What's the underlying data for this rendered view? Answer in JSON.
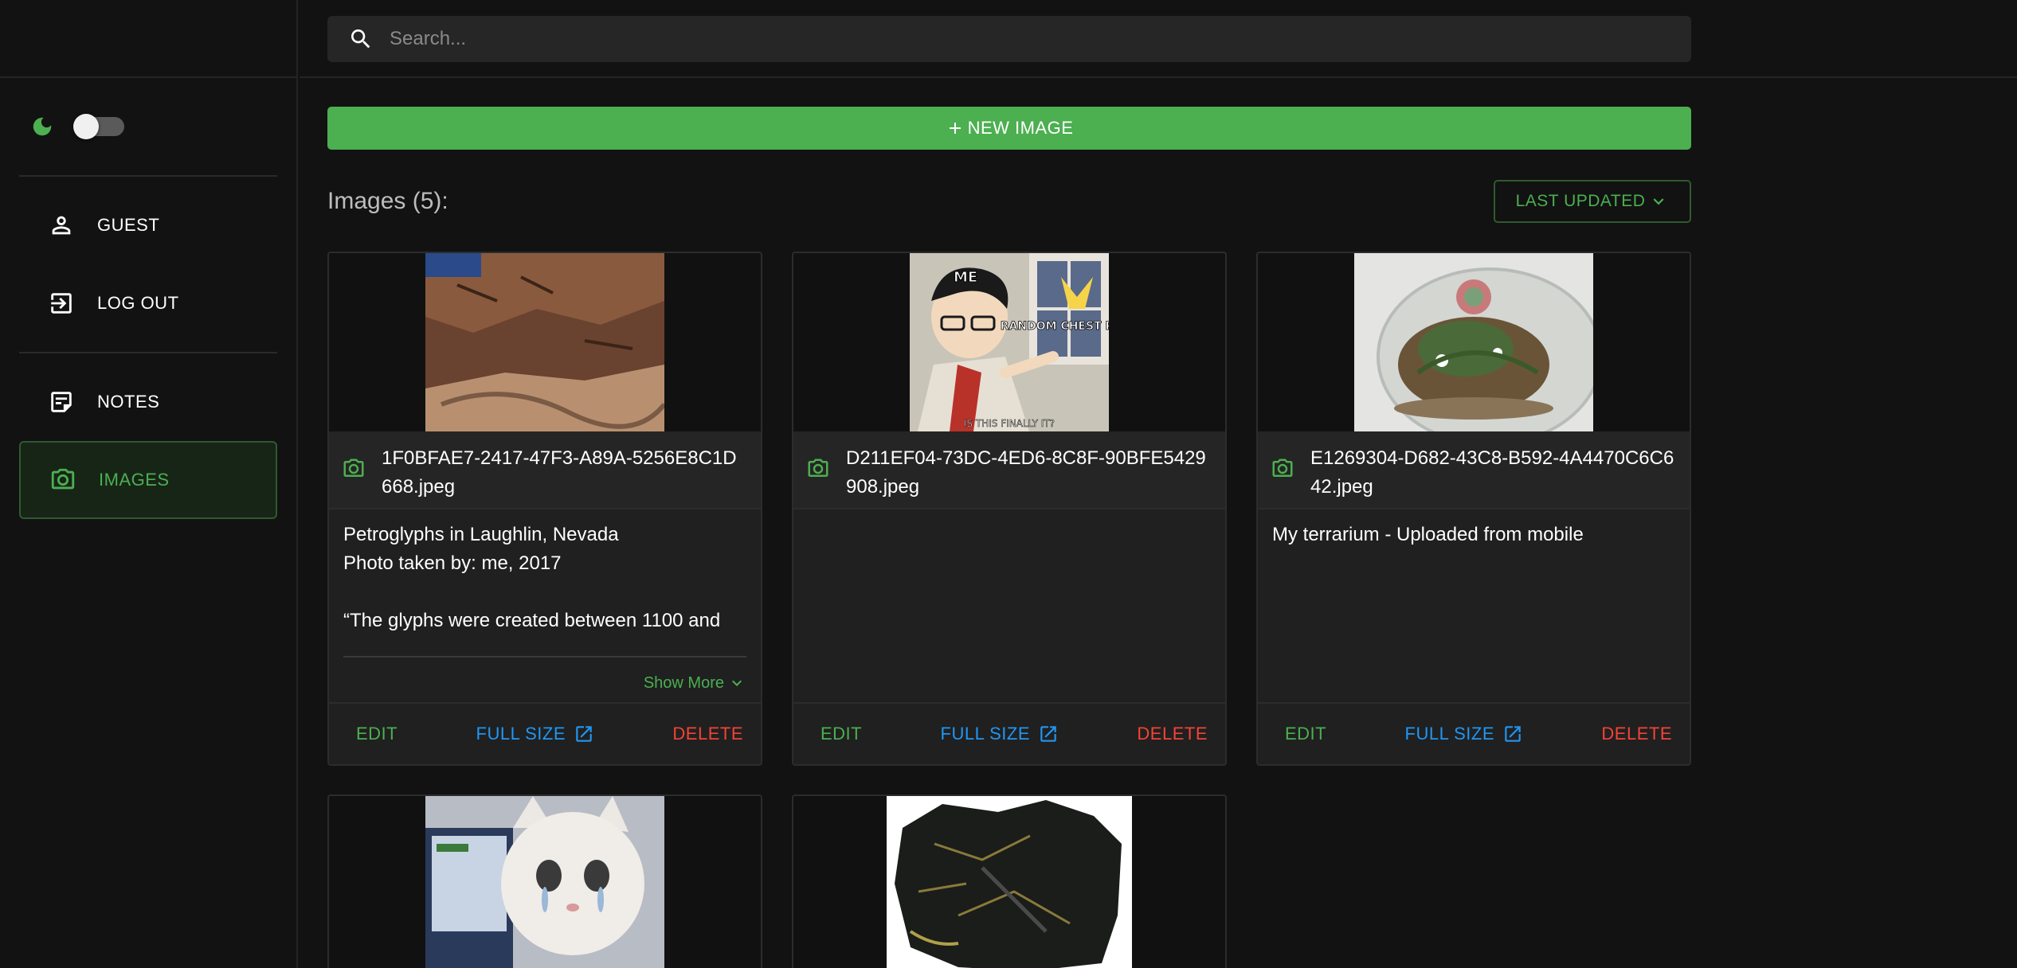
{
  "search": {
    "placeholder": "Search..."
  },
  "sidebar": {
    "items": [
      {
        "label": "GUEST",
        "icon": "person-icon"
      },
      {
        "label": "LOG OUT",
        "icon": "logout-icon"
      },
      {
        "label": "NOTES",
        "icon": "notes-icon"
      },
      {
        "label": "IMAGES",
        "icon": "camera-icon",
        "active": true
      }
    ]
  },
  "main": {
    "new_button_label": "NEW IMAGE",
    "list_title": "Images (5):",
    "sort_label": "LAST UPDATED"
  },
  "cards": [
    {
      "filename": "1F0BFAE7-2417-47F3-A89A-5256E8C1D668.jpeg",
      "description": "Petroglyphs in Laughlin, Nevada\nPhoto taken by: me, 2017\n\n“The glyphs were created between 1100 and",
      "show_more": "Show More"
    },
    {
      "filename": "D211EF04-73DC-4ED6-8C8F-90BFE5429908.jpeg",
      "description": "",
      "meme_top": "ME",
      "meme_right": "RANDOM CHEST PAIN",
      "meme_bottom": "IS THIS FINALLY IT?"
    },
    {
      "filename": "E1269304-D682-43C8-B592-4A4470C6C642.jpeg",
      "description": "My terrarium - Uploaded from mobile"
    }
  ],
  "actions": {
    "edit": "EDIT",
    "full_size": "FULL SIZE",
    "delete": "DELETE"
  },
  "colors": {
    "accent": "#4caf50",
    "link": "#2196f3",
    "danger": "#f44336",
    "bg": "#121212",
    "card": "#202020"
  }
}
